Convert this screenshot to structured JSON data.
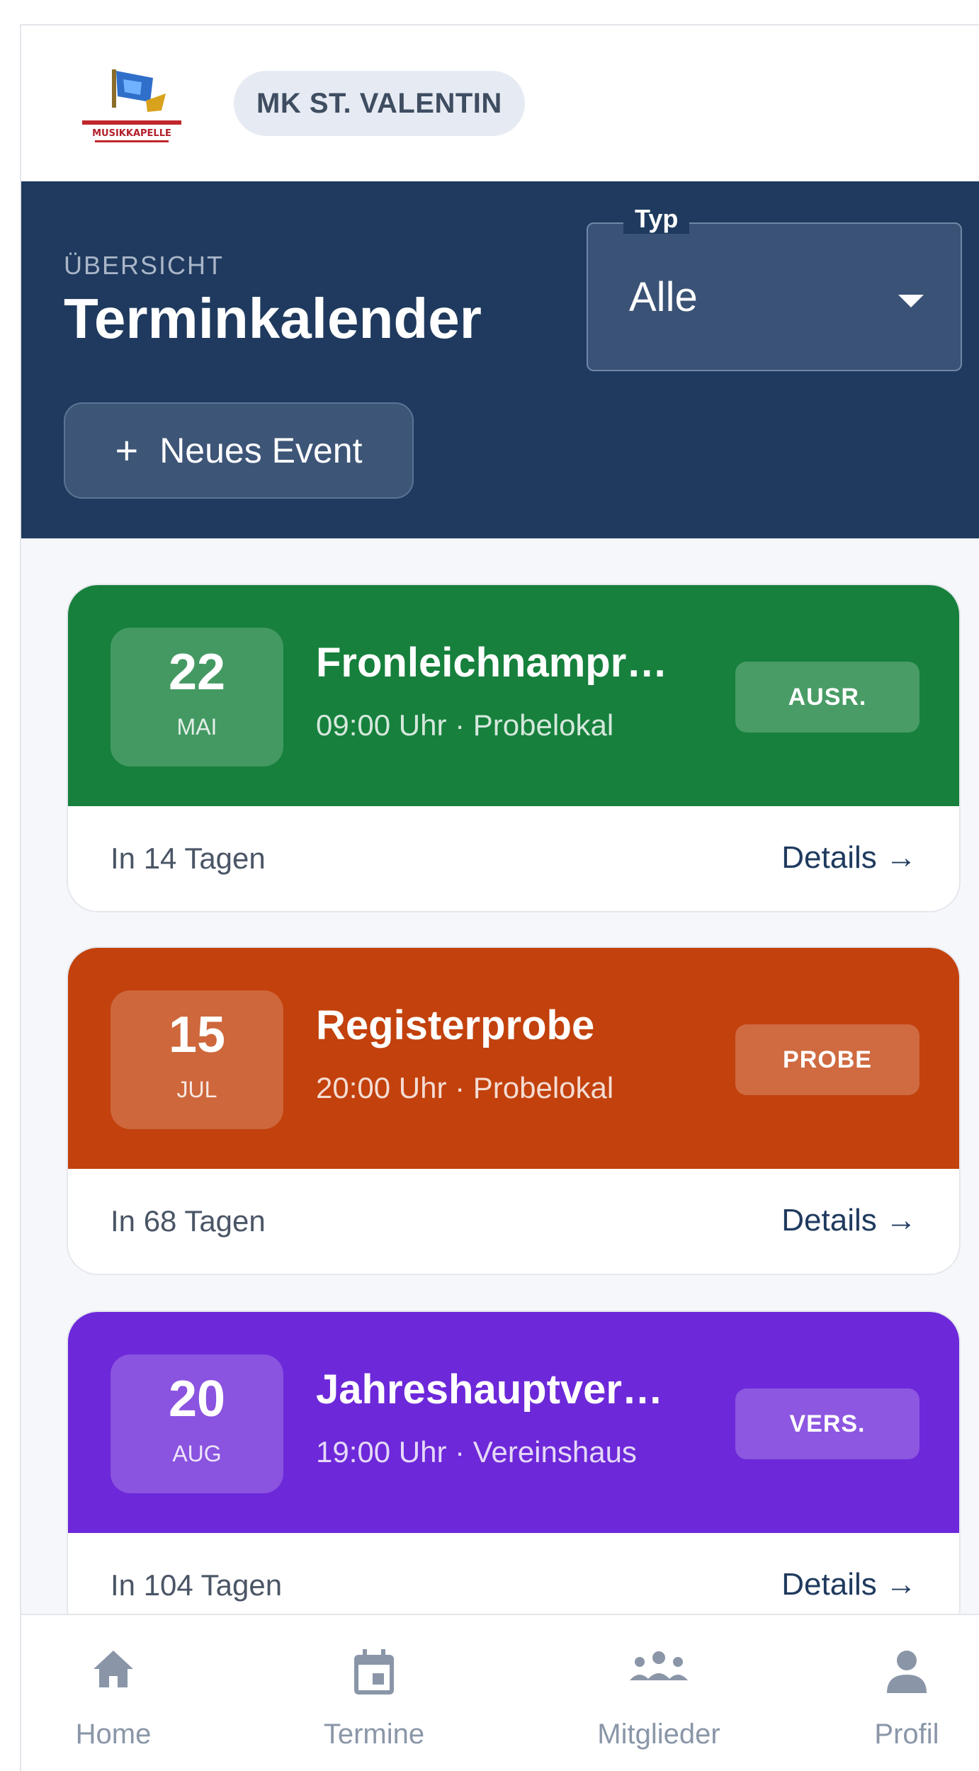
{
  "header": {
    "club_name": "MK ST. VALENTIN",
    "logo_text": "MUSIKKAPELLE"
  },
  "hero": {
    "eyebrow": "ÜBERSICHT",
    "title": "Terminkalender",
    "filter": {
      "label": "Typ",
      "value": "Alle"
    },
    "new_event_label": "Neues Event"
  },
  "events": [
    {
      "day": "22",
      "month": "MAI",
      "title": "Fronleichnamprozession",
      "meta": "09:00 Uhr · Probelokal",
      "badge": "AUSR.",
      "color": "#16803c",
      "days_left": "In 14 Tagen",
      "details": "Details →"
    },
    {
      "day": "15",
      "month": "JUL",
      "title": "Registerprobe",
      "meta": "20:00 Uhr · Probelokal",
      "badge": "PROBE",
      "color": "#c2410c",
      "days_left": "In 68 Tagen",
      "details": "Details →"
    },
    {
      "day": "20",
      "month": "AUG",
      "title": "Jahreshauptversammlung",
      "meta": "19:00 Uhr · Vereinshaus",
      "badge": "VERS.",
      "color": "#6d28d9",
      "days_left": "In 104 Tagen",
      "details": "Details →"
    }
  ],
  "nav": {
    "items": [
      {
        "label": "Home",
        "icon": "home-icon"
      },
      {
        "label": "Termine",
        "icon": "calendar-icon"
      },
      {
        "label": "Mitglieder",
        "icon": "group-icon"
      },
      {
        "label": "Profil",
        "icon": "person-icon"
      }
    ]
  },
  "colors": {
    "header_bg": "#1f3a5e",
    "green": "#16803c",
    "orange": "#c2410c",
    "purple": "#6d28d9"
  }
}
